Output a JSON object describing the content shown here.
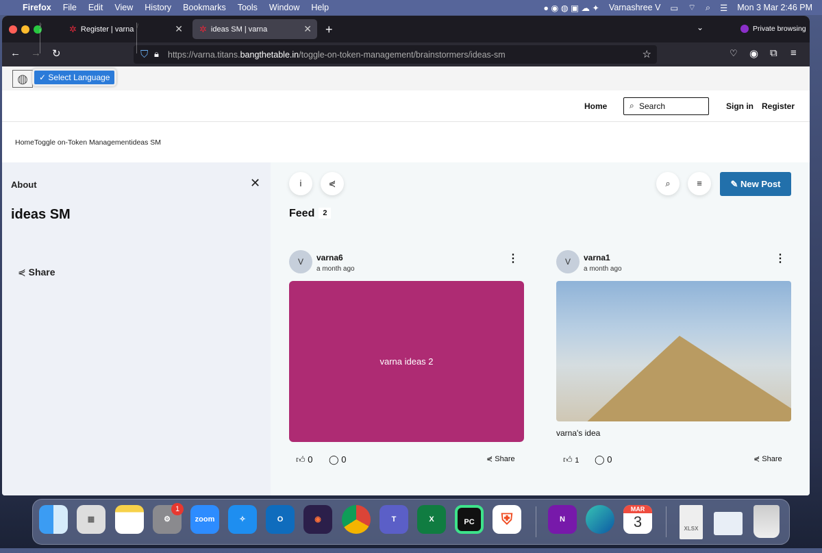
{
  "menubar": {
    "app": "Firefox",
    "items": [
      "File",
      "Edit",
      "View",
      "History",
      "Bookmarks",
      "Tools",
      "Window",
      "Help"
    ],
    "user": "Varnashree V",
    "datetime": "Mon 3 Mar  2:46 PM"
  },
  "browser": {
    "tabs": [
      {
        "title": "Register | varna"
      },
      {
        "title": "ideas SM | varna"
      }
    ],
    "private": "Private browsing",
    "url_pre": "https://varna.titans.",
    "url_host": "bangthetable.in",
    "url_post": "/toggle-on-token-management/brainstormers/ideas-sm"
  },
  "lang": {
    "label": "✓ Select Language"
  },
  "header": {
    "home": "Home",
    "search_placeholder": "Search",
    "signin": "Sign in",
    "register": "Register"
  },
  "breadcrumb": [
    "Home",
    "Toggle on-Token Management",
    "ideas SM"
  ],
  "about": {
    "label": "About",
    "title": "ideas SM",
    "share": "Share"
  },
  "toolbar": {
    "info": "i",
    "new_post": "New Post"
  },
  "feed": {
    "label": "Feed",
    "count": "2"
  },
  "posts": [
    {
      "avatar": "V",
      "user": "varna6",
      "time": "a month ago",
      "card_text": "varna ideas 2",
      "card_color": "#ae2b73",
      "likes": "0",
      "comments": "0",
      "share": "Share"
    },
    {
      "avatar": "V",
      "user": "varna1",
      "time": "a month ago",
      "caption": "varna's idea",
      "likes": "1",
      "comments": "0",
      "share": "Share"
    }
  ],
  "dock": {
    "zoom": "zoom",
    "calendar_month": "MAR",
    "calendar_day": "3",
    "settings_badge": "1",
    "pycharm": "PC",
    "outlook": "O",
    "teams": "T",
    "excel": "X",
    "onenote": "N",
    "xlsx": "XLSX"
  }
}
